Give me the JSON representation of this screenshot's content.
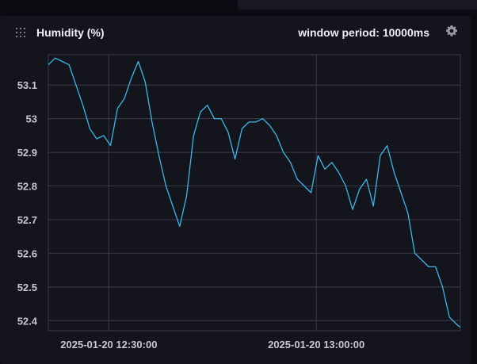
{
  "panel": {
    "title": "Humidity (%)",
    "window_period": "window period: 10000ms",
    "icons": {
      "drag": "drag-handle-icon",
      "settings": "gear-icon"
    }
  },
  "colors": {
    "line": "#3ab8e8",
    "grid": "#3a3a4c",
    "axis_text": "#c8c8d4",
    "background": "#14141d"
  },
  "chart_data": {
    "type": "line",
    "title": "",
    "xlabel": "",
    "ylabel": "",
    "y_ticks": [
      52.4,
      52.5,
      52.6,
      52.7,
      52.8,
      52.9,
      53,
      53.1
    ],
    "y_tick_labels": [
      "52.4",
      "52.5",
      "52.6",
      "52.7",
      "52.8",
      "52.9",
      "53",
      "53.1"
    ],
    "ylim": [
      52.37,
      53.19
    ],
    "x_ticks": [
      "2025-01-20 12:30:00",
      "2025-01-20 13:00:00"
    ],
    "x_tick_labels": [
      "2025-01-20 12:30:00",
      "2025-01-20 13:00:00"
    ],
    "xlim": [
      "2025-01-20 12:21:15",
      "2025-01-20 13:20:50"
    ],
    "grid": true,
    "series": [
      {
        "x": [
          "2025-01-20 12:21:15",
          "2025-01-20 12:22:15",
          "2025-01-20 12:23:15",
          "2025-01-20 12:24:15",
          "2025-01-20 12:25:15",
          "2025-01-20 12:26:15",
          "2025-01-20 12:27:15",
          "2025-01-20 12:28:15",
          "2025-01-20 12:29:15",
          "2025-01-20 12:30:15",
          "2025-01-20 12:31:15",
          "2025-01-20 12:32:15",
          "2025-01-20 12:33:15",
          "2025-01-20 12:34:15",
          "2025-01-20 12:35:15",
          "2025-01-20 12:36:15",
          "2025-01-20 12:37:15",
          "2025-01-20 12:38:15",
          "2025-01-20 12:39:15",
          "2025-01-20 12:40:15",
          "2025-01-20 12:41:15",
          "2025-01-20 12:42:15",
          "2025-01-20 12:43:15",
          "2025-01-20 12:44:15",
          "2025-01-20 12:45:15",
          "2025-01-20 12:46:15",
          "2025-01-20 12:47:15",
          "2025-01-20 12:48:15",
          "2025-01-20 12:49:15",
          "2025-01-20 12:50:15",
          "2025-01-20 12:51:15",
          "2025-01-20 12:52:15",
          "2025-01-20 12:53:15",
          "2025-01-20 12:54:15",
          "2025-01-20 12:55:15",
          "2025-01-20 12:56:15",
          "2025-01-20 12:57:15",
          "2025-01-20 12:58:15",
          "2025-01-20 12:59:15",
          "2025-01-20 13:00:15",
          "2025-01-20 13:01:15",
          "2025-01-20 13:02:15",
          "2025-01-20 13:03:15",
          "2025-01-20 13:04:15",
          "2025-01-20 13:05:15",
          "2025-01-20 13:06:15",
          "2025-01-20 13:07:15",
          "2025-01-20 13:08:15",
          "2025-01-20 13:09:15",
          "2025-01-20 13:10:15",
          "2025-01-20 13:11:15",
          "2025-01-20 13:12:15",
          "2025-01-20 13:13:15",
          "2025-01-20 13:14:15",
          "2025-01-20 13:15:15",
          "2025-01-20 13:16:15",
          "2025-01-20 13:17:15",
          "2025-01-20 13:18:15",
          "2025-01-20 13:19:15",
          "2025-01-20 13:20:15",
          "2025-01-20 13:20:50"
        ],
        "values": [
          53.16,
          53.18,
          53.17,
          53.16,
          53.1,
          53.04,
          52.97,
          52.94,
          52.95,
          52.92,
          53.03,
          53.06,
          53.12,
          53.17,
          53.11,
          52.99,
          52.89,
          52.8,
          52.74,
          52.68,
          52.77,
          52.95,
          53.02,
          53.04,
          53.0,
          53.0,
          52.96,
          52.88,
          52.97,
          52.99,
          52.99,
          53.0,
          52.98,
          52.95,
          52.9,
          52.87,
          52.82,
          52.8,
          52.78,
          52.89,
          52.85,
          52.87,
          52.84,
          52.8,
          52.73,
          52.79,
          52.82,
          52.74,
          52.89,
          52.92,
          52.84,
          52.78,
          52.72,
          52.6,
          52.58,
          52.56,
          52.56,
          52.5,
          52.41,
          52.39,
          52.38
        ]
      }
    ]
  }
}
